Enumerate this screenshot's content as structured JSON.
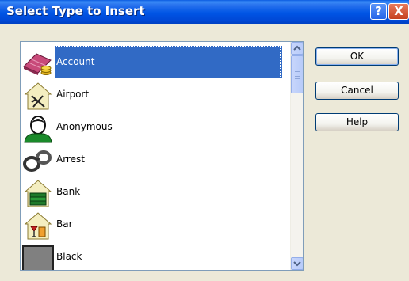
{
  "window": {
    "title": "Select Type to Insert",
    "help_glyph": "?",
    "close_glyph": "X"
  },
  "list": {
    "items": [
      {
        "label": "Account",
        "icon": "account-icon",
        "selected": true
      },
      {
        "label": "Airport",
        "icon": "airport-icon"
      },
      {
        "label": "Anonymous",
        "icon": "anonymous-icon"
      },
      {
        "label": "Arrest",
        "icon": "handcuffs-icon"
      },
      {
        "label": "Bank",
        "icon": "bank-icon"
      },
      {
        "label": "Bar",
        "icon": "bar-icon"
      },
      {
        "label": "Black",
        "icon": "black-icon"
      }
    ]
  },
  "buttons": {
    "ok": "OK",
    "cancel": "Cancel",
    "help": "Help"
  },
  "colors": {
    "selection": "#316ac5",
    "title_bar": "#0055e5",
    "dialog_bg": "#ece9d8"
  }
}
